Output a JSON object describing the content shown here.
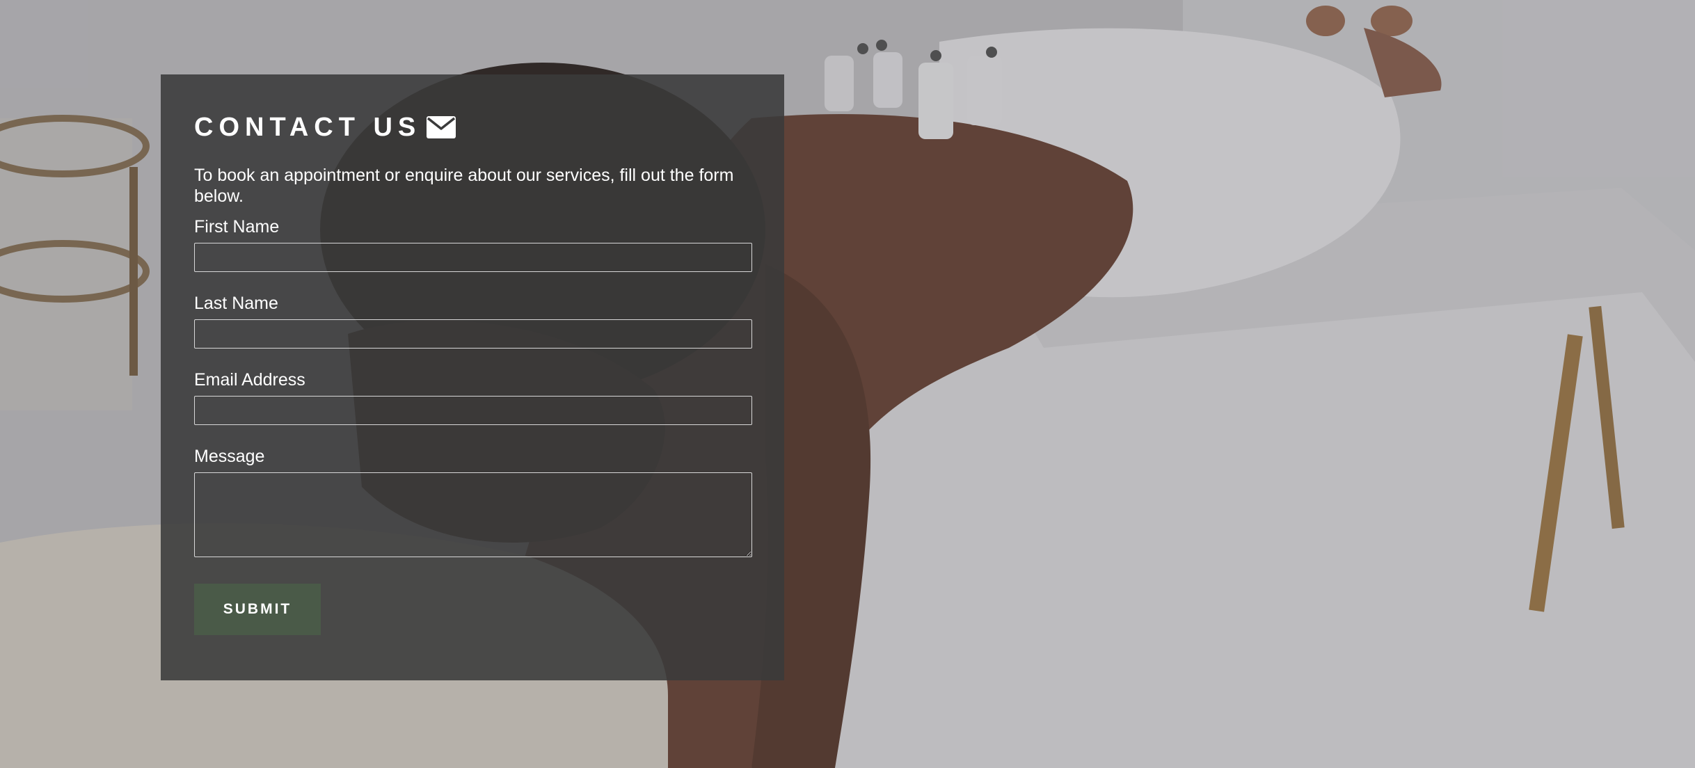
{
  "contact": {
    "title": "CONTACT US",
    "title_icon": "envelope-icon",
    "intro": "To book an appointment or enquire about our services, fill out the form below.",
    "fields": {
      "first_name_label": "First Name",
      "first_name_value": "",
      "last_name_label": "Last Name",
      "last_name_value": "",
      "email_label": "Email Address",
      "email_value": "",
      "message_label": "Message",
      "message_value": ""
    },
    "submit_label": "SUBMIT"
  },
  "colors": {
    "panel_background": "#3a3a3a",
    "submit_background": "#4a5a48",
    "text": "#ffffff"
  }
}
